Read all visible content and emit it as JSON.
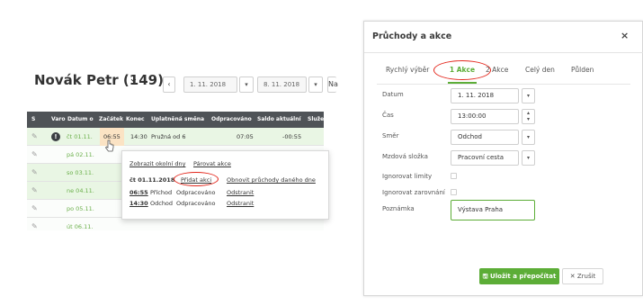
{
  "employee": {
    "name": "Novák Petr (149)",
    "caret_icon": "chevron-down-icon"
  },
  "toolbar": {
    "prev_label": "‹",
    "date_from": "1. 11. 2018",
    "date_to": "8. 11. 2018",
    "dd_label": "▾",
    "cut_label": "Na"
  },
  "grid": {
    "columns": [
      "S",
      "Varo",
      "Datum o",
      "Začátek",
      "Konec",
      "Uplatněná směna",
      "Odpracováno",
      "Saldo aktuální",
      "Služební ces"
    ],
    "rows": [
      {
        "date": "čt 01.11.",
        "start": "06:55",
        "end": "14:30",
        "shift": "Pružná od 6",
        "worked": "07:05",
        "saldo": "-00:55"
      },
      {
        "date": "pá 02.11."
      },
      {
        "date": "so 03.11."
      },
      {
        "date": "ne 04.11."
      },
      {
        "date": "po 05.11."
      },
      {
        "date": "út 06.11."
      }
    ]
  },
  "popup": {
    "link_show_days": "Zobrazit okolní dny",
    "link_pair": "Párovat akce",
    "date": "čt 01.11.2018",
    "add_action": "Přidat akci",
    "restore": "Obnovit průchody daného dne",
    "entries": [
      {
        "time": "06:55",
        "type": "Příchod",
        "status": "Odpracováno",
        "remove": "Odstranit"
      },
      {
        "time": "14:30",
        "type": "Odchod",
        "status": "Odpracováno",
        "remove": "Odstranit"
      }
    ]
  },
  "modal": {
    "title": "Průchody a akce",
    "close": "×",
    "tabs": [
      "Rychlý výběr",
      "1 Akce",
      "2 Akce",
      "Celý den",
      "Půlden"
    ],
    "fields": {
      "datum_label": "Datum",
      "datum_value": "1. 11. 2018",
      "cas_label": "Čas",
      "cas_value": "13:00:00",
      "smer_label": "Směr",
      "smer_value": "Odchod",
      "mzdova_label": "Mzdová složka",
      "mzdova_value": "Pracovní cesta",
      "ignore_limits_label": "Ignorovat limity",
      "ignore_round_label": "Ignorovat zarovnání",
      "note_label": "Poznámka",
      "note_value": "Výstava Praha"
    },
    "save_label": "Uložit a přepočítat",
    "cancel_label": "Zrušit"
  },
  "colors": {
    "accent_green": "#5cad37",
    "highlight_red": "#e3261b",
    "header_dark": "#4f5357"
  }
}
